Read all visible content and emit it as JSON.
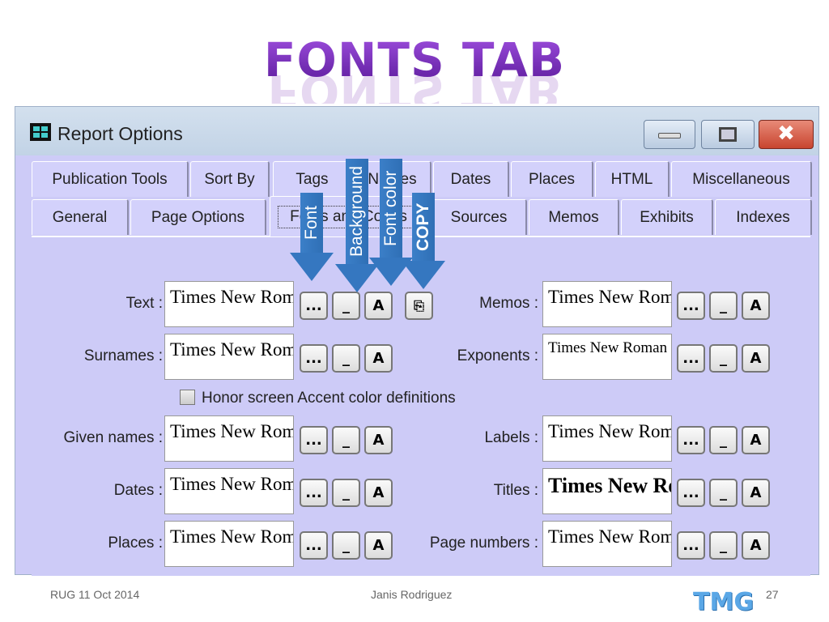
{
  "slide": {
    "title": "FONTS TAB",
    "footer_left": "RUG 11 Oct 2014",
    "footer_center": "Janis Rodriguez",
    "page_number": "27",
    "logo": "TMG"
  },
  "window": {
    "title": "Report Options",
    "icon": "report-grid-icon"
  },
  "tabs_row1": [
    "Publication Tools",
    "Sort By",
    "Tags",
    "Names",
    "Dates",
    "Places",
    "HTML",
    "Miscellaneous"
  ],
  "tabs_row2": [
    "General",
    "Page Options",
    "Fonts and Colors",
    "Sources",
    "Memos",
    "Exhibits",
    "Indexes"
  ],
  "selected_tab": "Fonts and Colors",
  "buttons": {
    "font": "...",
    "background": "_",
    "color": "A"
  },
  "left_rows": [
    {
      "label": "Text :",
      "font": "Times New Roman"
    },
    {
      "label": "Surnames :",
      "font": "Times New Roman"
    },
    {
      "label": "Given names :",
      "font": "Times New Roman"
    },
    {
      "label": "Dates :",
      "font": "Times New Roman"
    },
    {
      "label": "Places :",
      "font": "Times New Roman"
    }
  ],
  "right_rows": [
    {
      "label": "Memos :",
      "font": "Times New Roman"
    },
    {
      "label": "Exponents :",
      "font": "Times New Roman"
    },
    {
      "label": "Labels :",
      "font": "Times New Roman"
    },
    {
      "label": "Titles :",
      "font": "Times New Roman"
    },
    {
      "label": "Page numbers :",
      "font": "Times New Roman"
    }
  ],
  "checkbox": {
    "label": "Honor screen Accent color definitions",
    "checked": false
  },
  "callouts": [
    "Font",
    "Background",
    "Font color",
    "COPY"
  ],
  "colors": {
    "panel": "#cdcbf7",
    "arrow": "#3577c0",
    "title": "#7a2fb8",
    "close": "#c8452f"
  }
}
